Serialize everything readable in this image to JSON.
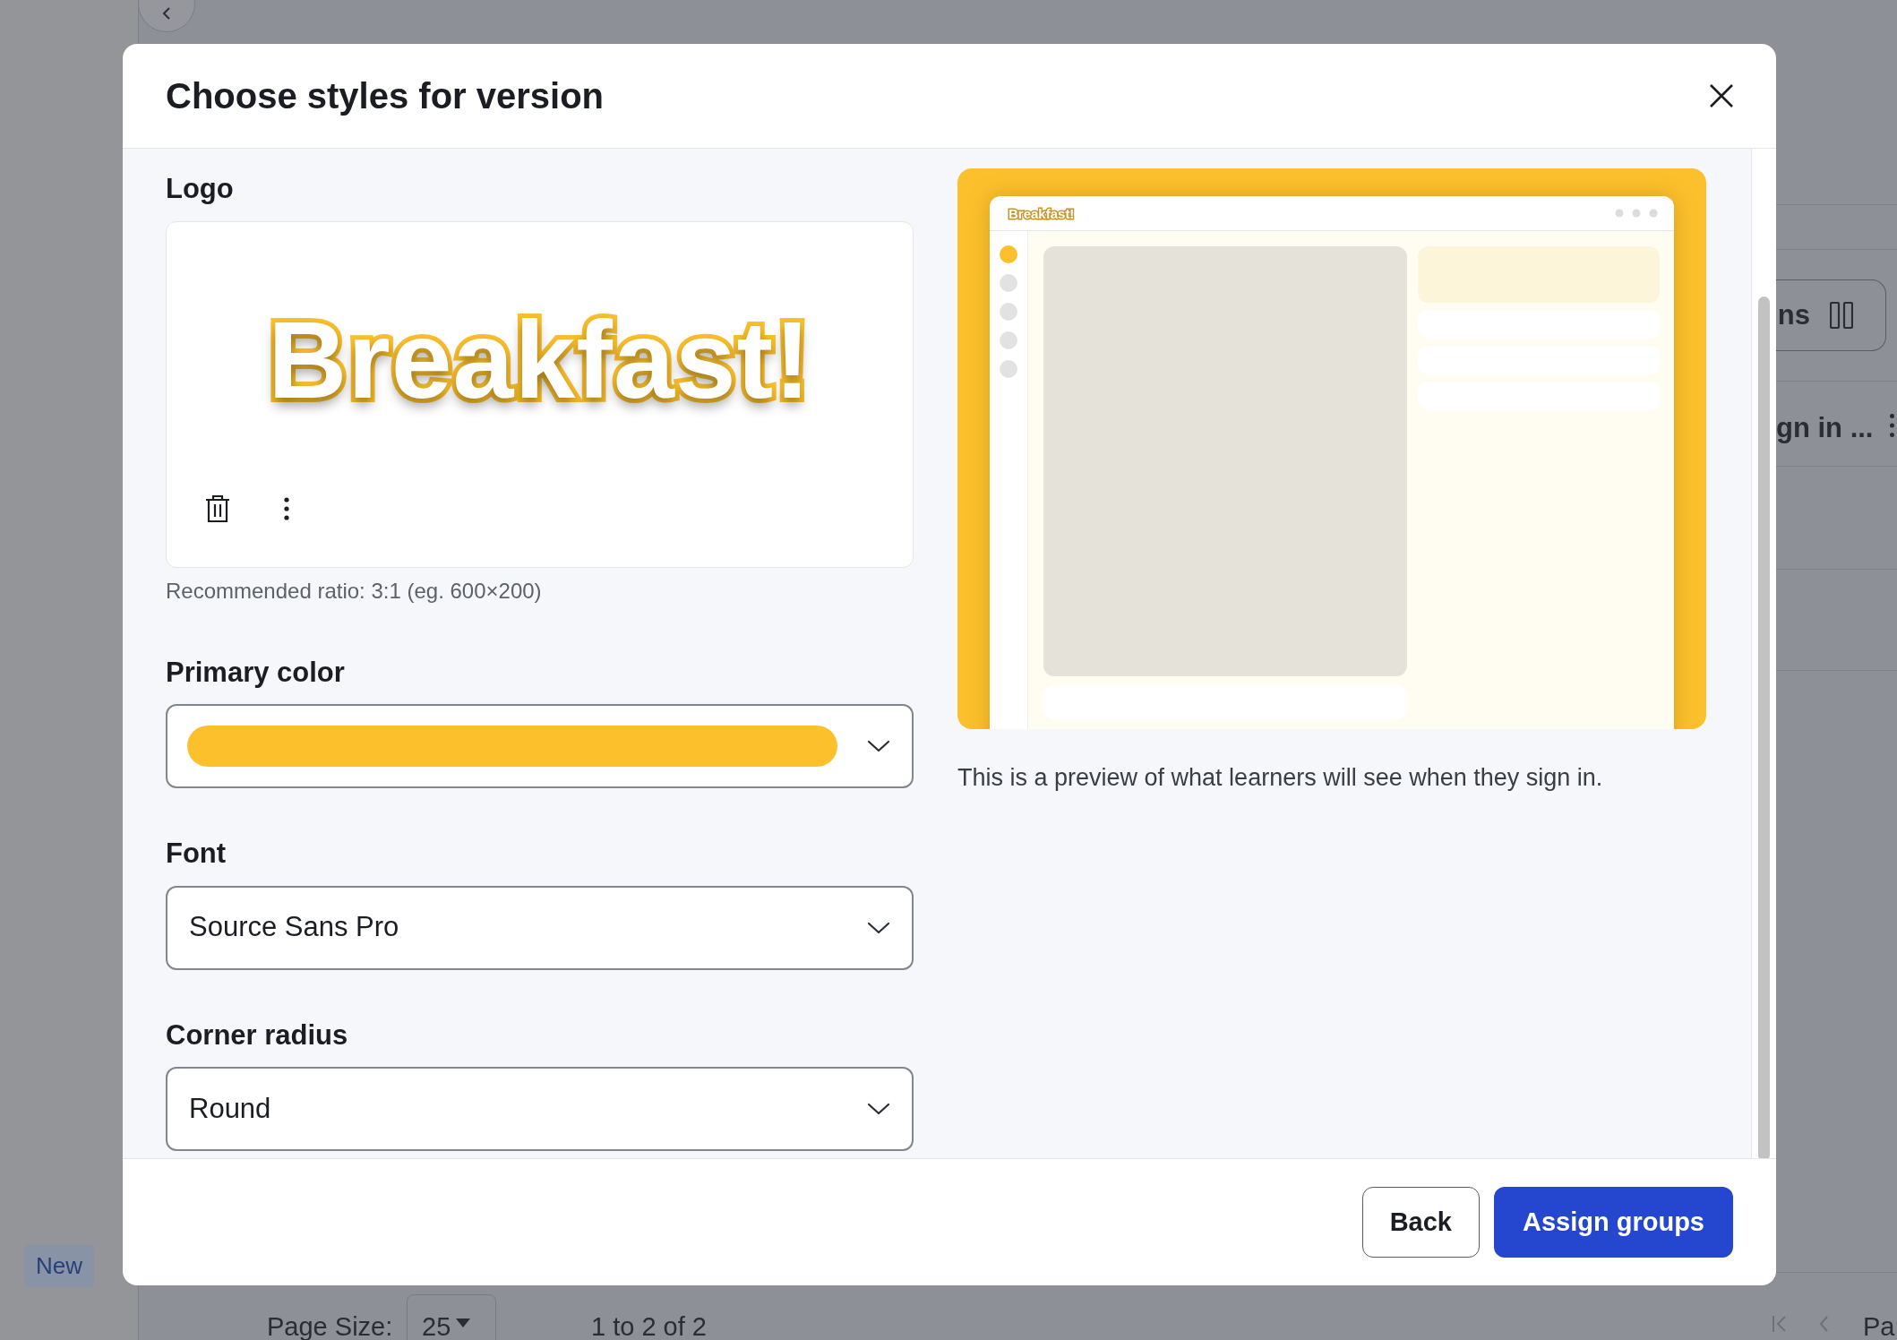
{
  "dialog": {
    "title": "Choose styles for version"
  },
  "logo": {
    "label": "Logo",
    "image_text": "Breakfast!",
    "caption": "Recommended ratio: 3:1 (eg. 600×200)"
  },
  "fields": [
    {
      "label": "Primary color",
      "kind": "color",
      "color": "#fcc02d"
    },
    {
      "label": "Font",
      "kind": "select",
      "value": "Source Sans Pro"
    },
    {
      "label": "Corner radius",
      "kind": "select",
      "value": "Round"
    }
  ],
  "preview": {
    "logo_text": "Breakfast!",
    "nav_dots": [
      {
        "selected": true
      },
      {
        "selected": false
      },
      {
        "selected": false
      },
      {
        "selected": false
      },
      {
        "selected": false
      }
    ],
    "caption": "This is a preview of what learners will see when they sign in."
  },
  "buttons": [
    {
      "label": "Back",
      "kind": "secondary"
    },
    {
      "label": "Assign groups",
      "kind": "primary"
    }
  ],
  "background": {
    "columns_button": "ns",
    "row_text": "gn in ...",
    "badge": "New",
    "page_size_label": "Page Size:",
    "page_size": "25",
    "range": "1 to 2 of 2",
    "page_label": "Pa"
  }
}
